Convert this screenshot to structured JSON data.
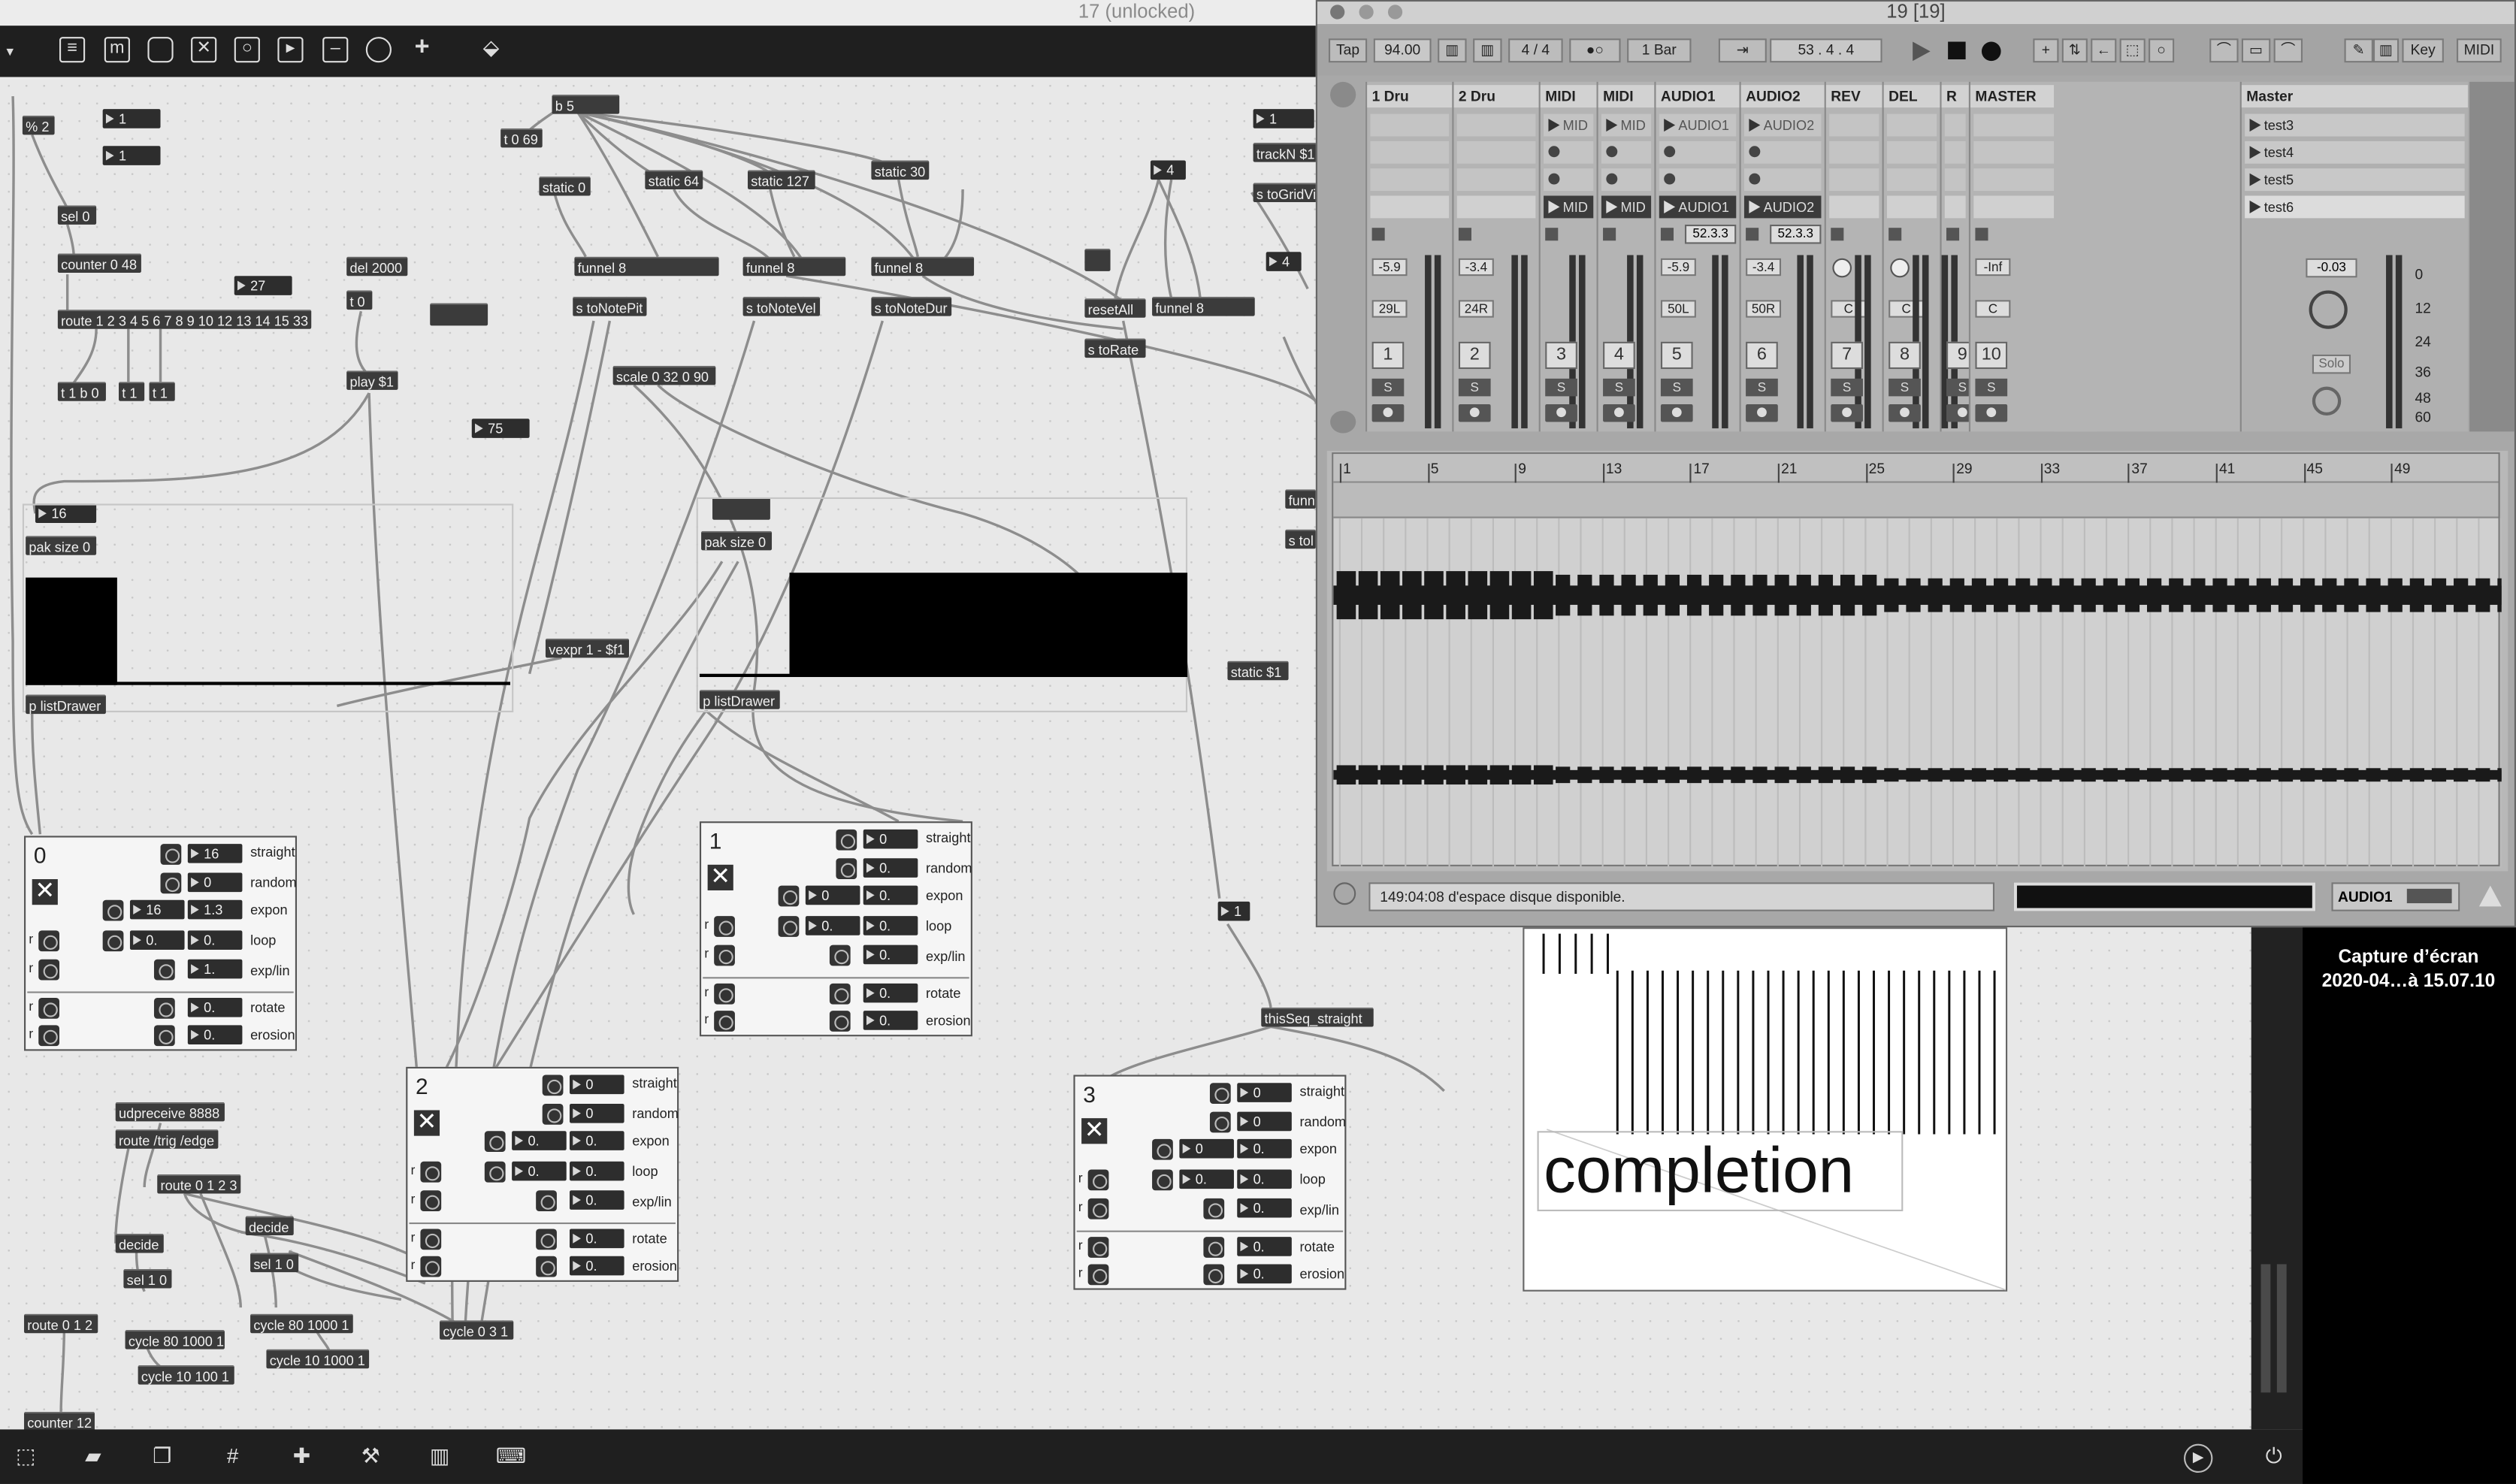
{
  "max": {
    "window_title": "17 (unlocked)",
    "objects": {
      "mod2": "% 2",
      "num1a": "1",
      "num1b": "1",
      "sel0": "sel 0",
      "counter048": "counter 0 48",
      "num27": "27",
      "del2000": "del 2000",
      "t0": "t 0",
      "route1": "route 1 2 3 4 5 6 7 8 9 10 12 13 14 15 33",
      "t1b0": "t 1 b 0",
      "t1a": "t 1",
      "t1b": "t 1",
      "playS1": "play $1",
      "b5": "b 5",
      "t069": "t 0 69",
      "static0": "static 0",
      "static64": "static 64",
      "static127": "static 127",
      "static30": "static 30",
      "funnel8a": "funnel 8",
      "funnel8b": "funnel 8",
      "funnel8c": "funnel 8",
      "funnel8d": "funnel 8",
      "stoNotePit": "s toNotePit",
      "stoNoteVel": "s toNoteVel",
      "stoNoteDur": "s toNoteDur",
      "resetAll": "resetAll",
      "stoRate": "s toRate",
      "num4a": "4",
      "num4b": "4",
      "num1c": "1",
      "trackN": "trackN $1",
      "stoGridVi": "s toGridVi",
      "scale": "scale 0 32 0 90",
      "num75": "75",
      "num16": "16",
      "paksize0a": "pak size 0",
      "paksize0b": "pak size 0",
      "listDrawerA": "p listDrawer",
      "listDrawerB": "p listDrawer",
      "vexpr": "vexpr 1 - $f1",
      "staticS1": "static $1",
      "funn": "funn",
      "stol": "s tol",
      "num1d": "1",
      "thisSeq": "thisSeq_straight",
      "udpreceive": "udpreceive 8888",
      "routeTrig": "route /trig /edge",
      "route0123": "route 0 1 2 3",
      "decide1": "decide",
      "decide2": "decide",
      "sel10a": "sel 1 0",
      "sel10b": "sel 1 0",
      "route012": "route 0 1 2",
      "cycle80a": "cycle 80 1000 1",
      "cycle10a": "cycle 10 100 1",
      "cycle80b": "cycle 80 1000 1",
      "cycle10b": "cycle 10 1000 1",
      "cycle031": "cycle 0 3 1",
      "counter12": "counter 12"
    },
    "panels": [
      {
        "index": "0",
        "vals": [
          "16",
          "0",
          "16",
          "1.3",
          "0.",
          "0.",
          "1.",
          "0.",
          "0."
        ]
      },
      {
        "index": "1",
        "vals": [
          "0",
          "0.",
          "0",
          "0.",
          "0.",
          "0.",
          "0.",
          "0.",
          "0."
        ]
      },
      {
        "index": "2",
        "vals": [
          "0",
          "0",
          "0.",
          "0.",
          "0.",
          "0.",
          "0.",
          "0.",
          "0."
        ]
      },
      {
        "index": "3",
        "vals": [
          "0",
          "0",
          "0",
          "0.",
          "0.",
          "0.",
          "0.",
          "0.",
          "0."
        ]
      }
    ],
    "param_labels": {
      "straight": "straight",
      "random": "random",
      "expon": "expon",
      "loop": "loop",
      "explin": "exp/lin",
      "rotate": "rotate",
      "erosion": "erosion",
      "r": "r"
    },
    "completion_text": "completion"
  },
  "live": {
    "window_title": "19  [19]",
    "tap": "Tap",
    "tempo": "94.00",
    "signature": "4  /  4",
    "quantize": "1 Bar",
    "position": "53 .   4 .   4",
    "key_label": "Key",
    "midi_label": "MIDI",
    "tracks": [
      {
        "name": "1 Dru",
        "vol": "-5.9",
        "pan": "29L",
        "num": "1",
        "clip": "",
        "kind": "drum"
      },
      {
        "name": "2 Dru",
        "vol": "-3.4",
        "pan": "24R",
        "num": "2",
        "clip": "",
        "kind": "drum"
      },
      {
        "name": "MIDI",
        "vol": "",
        "pan": "",
        "num": "3",
        "clip": "MID",
        "kind": "midi"
      },
      {
        "name": "MIDI",
        "vol": "",
        "pan": "",
        "num": "4",
        "clip": "MID",
        "kind": "midi"
      },
      {
        "name": "AUDIO1",
        "vol": "-5.9",
        "pan": "50L",
        "num": "5",
        "clip": "AUDIO1",
        "kind": "audio",
        "cue": "52.3.3"
      },
      {
        "name": "AUDIO2",
        "vol": "-3.4",
        "pan": "50R",
        "num": "6",
        "clip": "AUDIO2",
        "kind": "audio",
        "cue": "52.3.3"
      },
      {
        "name": "REV",
        "vol": "",
        "pan": "C",
        "num": "7",
        "clip": "",
        "kind": "ret"
      },
      {
        "name": "DEL",
        "vol": "",
        "pan": "C",
        "num": "8",
        "clip": "",
        "kind": "ret"
      },
      {
        "name": "R",
        "vol": "",
        "pan": "",
        "num": "9",
        "clip": "",
        "kind": "ret"
      },
      {
        "name": "MASTER",
        "vol": "-Inf",
        "pan": "C",
        "num": "10",
        "clip": "",
        "kind": "master"
      }
    ],
    "master_scenes": [
      "test3",
      "test4",
      "test5",
      "test6"
    ],
    "master_label": "Master",
    "master_vol": "-0.03",
    "solo": "Solo",
    "db_scale": [
      "0",
      "12",
      "24",
      "36",
      "48",
      "60"
    ],
    "ruler": [
      "1",
      "5",
      "9",
      "13",
      "17",
      "21",
      "25",
      "29",
      "33",
      "37",
      "41",
      "45",
      "49"
    ],
    "status": "149:04:08 d'espace disque disponible.",
    "audio_track": "AUDIO1"
  },
  "screenshot_label": "Capture d’écran\n2020-04…à 15.07.10",
  "screenshot_line1": "Capture d’écran",
  "screenshot_line2": "2020-04…à 15.07.10"
}
